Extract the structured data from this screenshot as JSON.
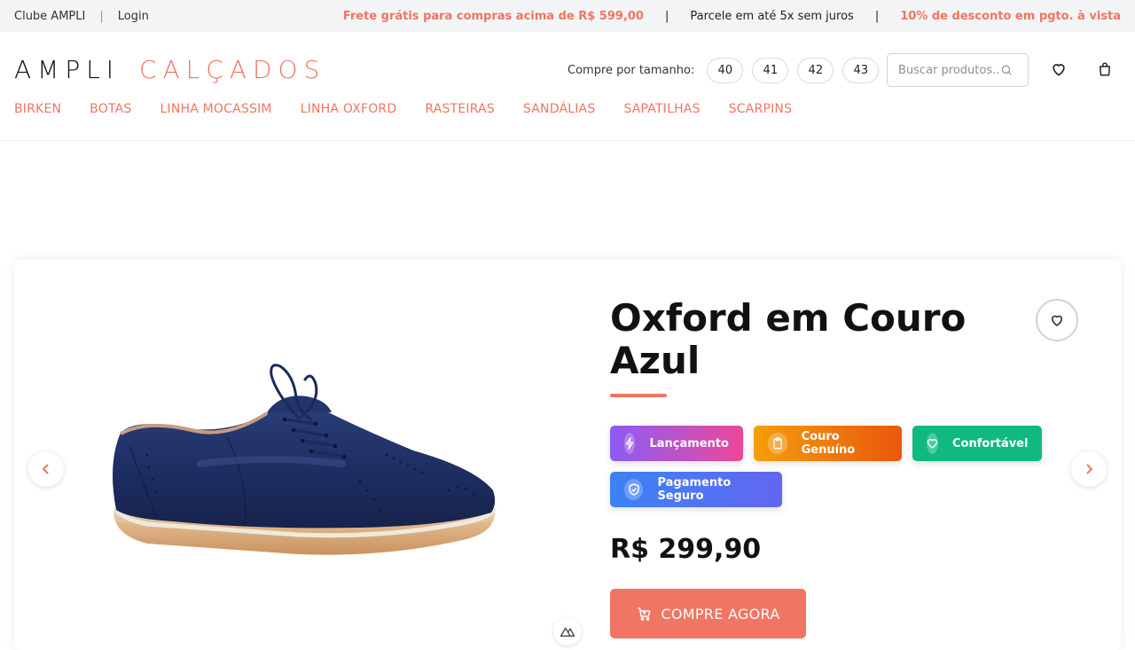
{
  "topbar": {
    "club": "Clube AMPLI",
    "separator": "|",
    "login": "Login",
    "promo_shipping": "Frete grátis para compras acima de R$ 599,00",
    "promo_installments": "Parcele em até 5x sem juros",
    "promo_discount": "10% de desconto em pgto. à vista",
    "bar": "|"
  },
  "header": {
    "logo_part1": "AMPLI",
    "logo_part2": "CALÇADOS",
    "size_label": "Compre por tamanho:",
    "sizes": [
      "40",
      "41",
      "42",
      "43"
    ],
    "search_placeholder": "Buscar produtos..."
  },
  "nav": [
    "BIRKEN",
    "BOTAS",
    "LINHA MOCASSIM",
    "LINHA OXFORD",
    "RASTEIRAS",
    "SANDÁLIAS",
    "SAPATILHAS",
    "SCARPINS"
  ],
  "product": {
    "title": "Oxford em Couro Azul",
    "badges": [
      {
        "label": "Lançamento",
        "icon": "bolt-icon"
      },
      {
        "label": "Couro Genuíno",
        "icon": "clipboard-icon"
      },
      {
        "label": "Confortável",
        "icon": "heart-icon"
      },
      {
        "label": "Pagamento Seguro",
        "icon": "shield-icon"
      }
    ],
    "price": "R$ 299,90",
    "buy_label": "COMPRE AGORA"
  },
  "colors": {
    "accent": "#f07560",
    "badge_launch": [
      "#8b5cf6",
      "#ec4899"
    ],
    "badge_leather": [
      "#f59e0b",
      "#ea580c"
    ],
    "badge_comfort": "#10b981",
    "badge_payment": [
      "#3b82f6",
      "#6366f1"
    ]
  }
}
